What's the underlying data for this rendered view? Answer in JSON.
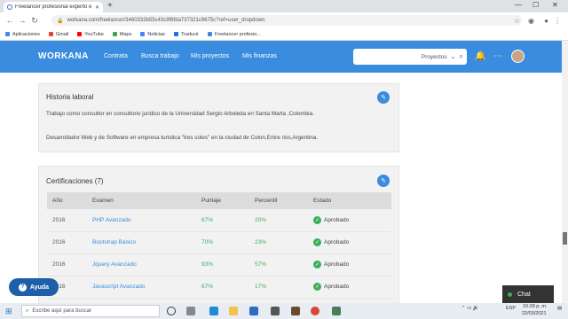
{
  "browser": {
    "tab_title": "Freelancer profesional experto e",
    "url": "workana.com/freelancer/3460332b55c43c9f8fda737321c9675c?ref=user_dropdown",
    "bookmarks": [
      "Aplicaciones",
      "Gmail",
      "YouTube",
      "Maps",
      "Noticias",
      "Traducir",
      "Freelancer profesio..."
    ]
  },
  "header": {
    "logo": "WORKANA",
    "menu": [
      "Contrata",
      "Busca trabajo",
      "Mis proyectos",
      "Mis finanzas"
    ],
    "search_placeholder": "Proyectos"
  },
  "historia": {
    "title": "Historia laboral",
    "p1": "Trabajo como consultor en consultorio juridico de la Universidad Sergio Arboleda en Santa Marta ,Colombia.",
    "p2": "Desarrollador Web y de Software en empresa turistica \"tres soles\" en la ciudad de Colon,Entre rios,Argentina."
  },
  "cert": {
    "title": "Certificaciones (7)",
    "headers": [
      "Año",
      "Examen",
      "Puntaje",
      "Percentil",
      "Estado"
    ],
    "rows": [
      [
        "2016",
        "PHP Avanzado",
        "67%",
        "20%",
        "Aprobado"
      ],
      [
        "2016",
        "Bootstrap Básico",
        "70%",
        "23%",
        "Aprobado"
      ],
      [
        "2016",
        "Jquery Avanzado",
        "93%",
        "57%",
        "Aprobado"
      ],
      [
        "2016",
        "Javascript Avanzado",
        "67%",
        "17%",
        "Aprobado"
      ]
    ]
  },
  "help_label": "Ayuda",
  "chat_label": "Chat",
  "taskbar": {
    "search_placeholder": "Escribe aquí para buscar",
    "lang": "ESP",
    "time": "10:28 p. m.",
    "date": "22/03/2021"
  },
  "colors": {
    "brand": "#3a8dde",
    "success": "#3fae5a"
  }
}
